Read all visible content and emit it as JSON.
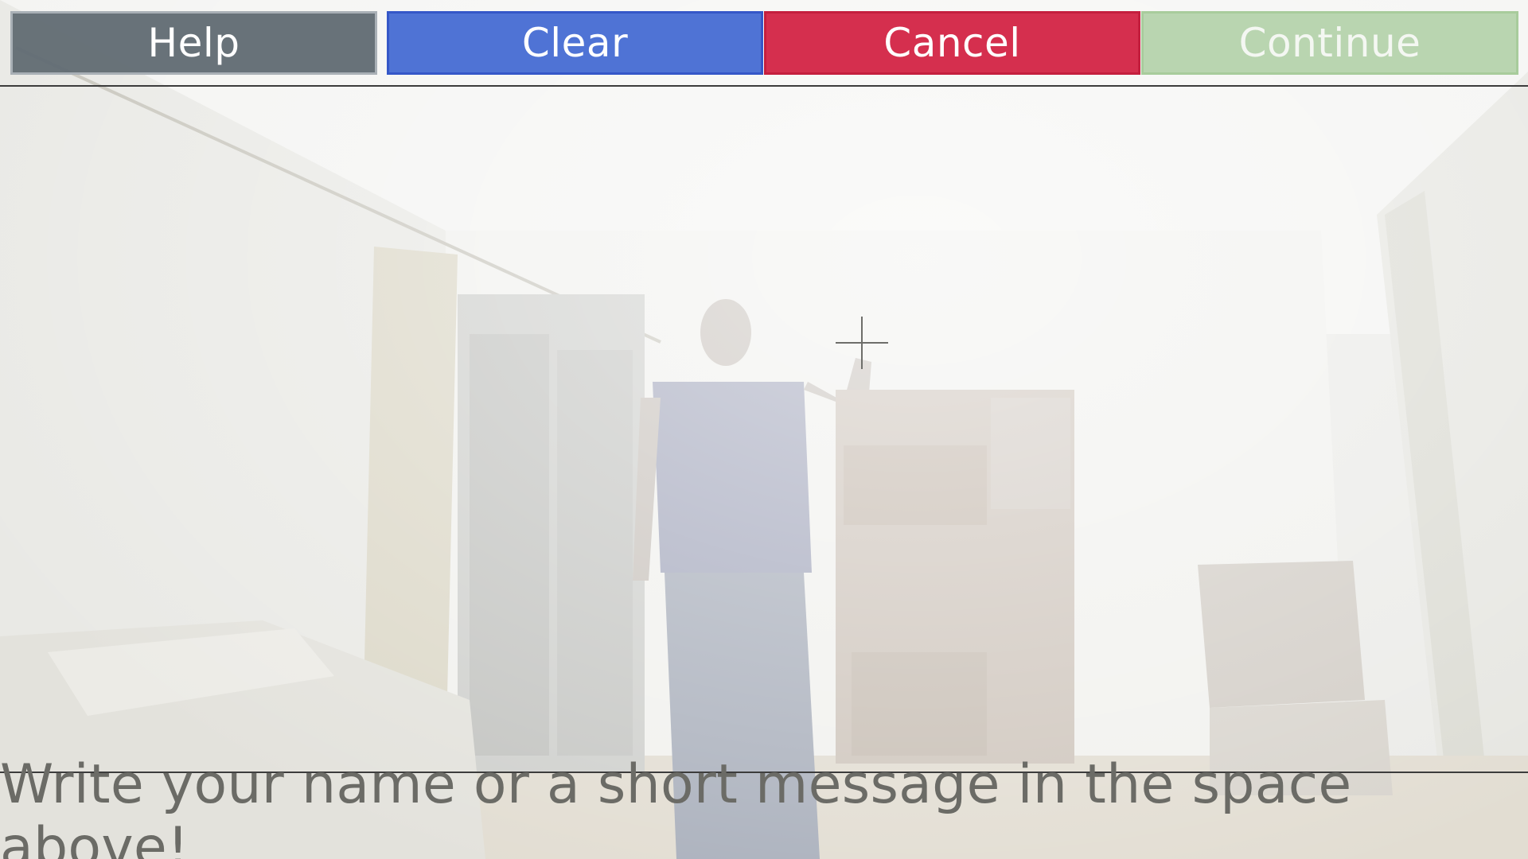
{
  "toolbar": {
    "help_label": "Help",
    "clear_label": "Clear",
    "cancel_label": "Cancel",
    "continue_label": "Continue"
  },
  "colors": {
    "help": "#626c74",
    "clear": "#496ed4",
    "cancel": "#d42848",
    "continue": "#b4d2aa",
    "instruction_text": "#6b6b66"
  },
  "canvas": {
    "cursor_icon": "crosshair-icon"
  },
  "footer": {
    "instruction": "Write your name or a short message in the space above!"
  }
}
